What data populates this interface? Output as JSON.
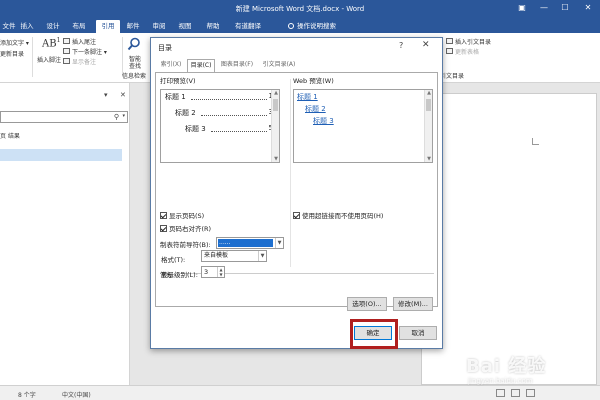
{
  "window": {
    "title": "新建 Microsoft Word 文档.docx - Word",
    "controls": {
      "restore": "▣",
      "minimize": "—",
      "maximize": "☐",
      "close": "✕"
    }
  },
  "ribbon_tabs": [
    {
      "label": "文件"
    },
    {
      "label": "插入"
    },
    {
      "label": "设计"
    },
    {
      "label": "布局"
    },
    {
      "label": "引用"
    },
    {
      "label": "邮件"
    },
    {
      "label": "审阅"
    },
    {
      "label": "视图"
    },
    {
      "label": "帮助"
    },
    {
      "label": "有道翻译"
    }
  ],
  "active_tab_index": 4,
  "tell_me": "操作说明搜索",
  "ribbon": {
    "add_text": "添加文字 ▾",
    "update_toc": "更新目录",
    "insert_footnote_big": "插入脚注",
    "insert_endnote": "插入尾注",
    "next_footnote": "下一条脚注 ▾",
    "show_notes": "显示备注",
    "smart_lookup": "智能",
    "smart_lookup2": "查找",
    "insights_group": "信息检索",
    "insert_table_of_authorities": "插入引文目录",
    "update_table": "更新表格",
    "toa_group": "引文目录"
  },
  "navpane": {
    "pane_arrow": "▾",
    "pane_close": "✕",
    "search_icon": "⚲",
    "search_dd": "▾",
    "tabs_text": "页    结果"
  },
  "status": {
    "words": "8 个字",
    "lang": "中文(中国)"
  },
  "dialog": {
    "title": "目录",
    "help": "?",
    "close": "✕",
    "tabs": [
      {
        "label": "索引(X)"
      },
      {
        "label": "目录(C)"
      },
      {
        "label": "图表目录(F)"
      },
      {
        "label": "引文目录(A)"
      }
    ],
    "print_preview_label": "打印预览(V)",
    "print_preview": [
      {
        "text": "标题 1",
        "page": "1"
      },
      {
        "text": "标题 2",
        "page": "3"
      },
      {
        "text": "标题 3",
        "page": "5"
      }
    ],
    "web_preview_label": "Web 预览(W)",
    "web_preview": [
      {
        "text": "标题 1"
      },
      {
        "text": "标题 2"
      },
      {
        "text": "标题 3"
      }
    ],
    "show_page_numbers": "显示页码(S)",
    "right_align": "页码右对齐(R)",
    "use_hyperlinks": "使用超链接而不使用页码(H)",
    "tab_leader_label": "制表符前导符(B):",
    "tab_leader_value": "......",
    "general_label": "常规",
    "formats_label": "格式(T):",
    "formats_value": "来自模板",
    "levels_label": "显示级别(L):",
    "levels_value": "3",
    "options_button": "选项(O)...",
    "modify_button": "修改(M)...",
    "ok_button": "确定",
    "cancel_button": "取消"
  },
  "watermark": {
    "main": "Bai 经验",
    "sub": "jingyan.baidu.com"
  }
}
